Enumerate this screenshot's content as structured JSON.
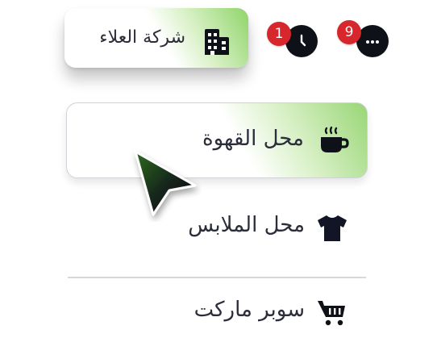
{
  "header": {
    "company_name": "شركة العلاء",
    "company_icon": "building-icon",
    "history_badge": "1",
    "history_icon": "clock-icon",
    "messages_badge": "9",
    "messages_icon": "chat-bubble-icon"
  },
  "menu": {
    "items": [
      {
        "label": "محل القهوة",
        "icon": "coffee-cup-icon",
        "active": true
      },
      {
        "label": "محل الملابس",
        "icon": "tshirt-icon",
        "active": false
      },
      {
        "label": "سوبر ماركت",
        "icon": "shopping-cart-icon",
        "active": false
      }
    ]
  },
  "colors": {
    "active_gradient": "#8fd46a",
    "badge": "#d7262c",
    "icon": "#0f1118",
    "text": "#2b2d3a",
    "divider": "#d6d8dc"
  }
}
